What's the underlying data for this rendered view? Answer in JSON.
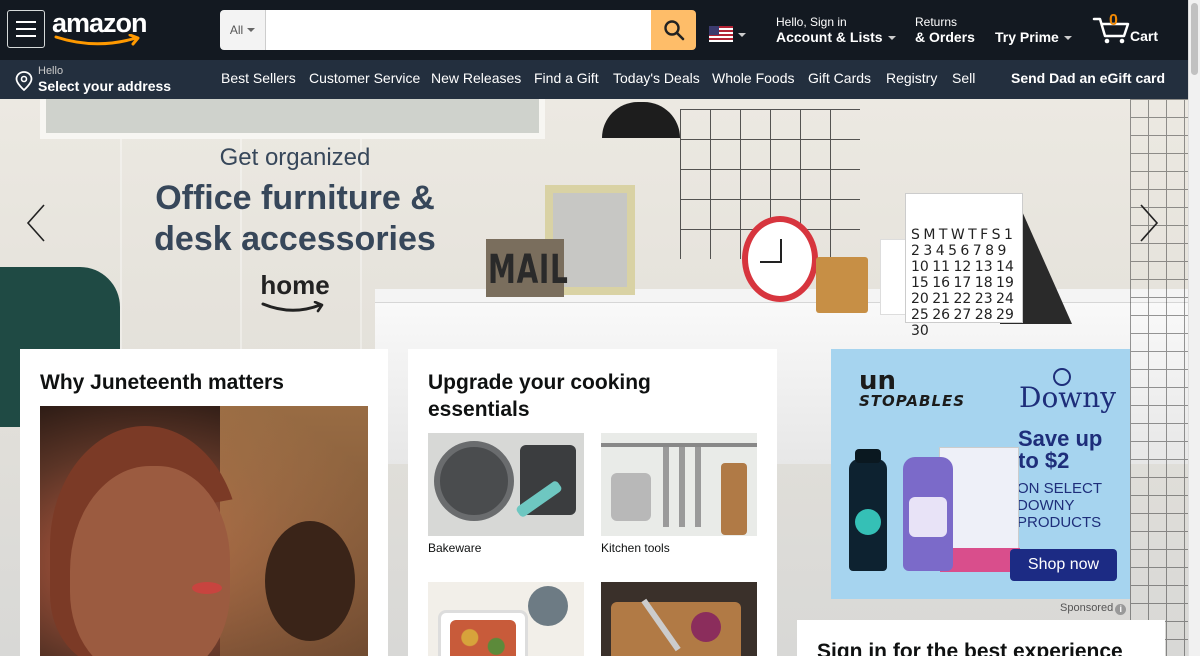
{
  "header": {
    "logo_text": "amazon",
    "search": {
      "category": "All",
      "placeholder": "",
      "value": ""
    },
    "flag": "us-flag-icon",
    "account": {
      "line1": "Hello, Sign in",
      "line2": "Account & Lists"
    },
    "orders": {
      "line1": "Returns",
      "line2": "& Orders"
    },
    "prime": {
      "label": "Try Prime"
    },
    "cart": {
      "count": "0",
      "label": "Cart"
    }
  },
  "subnav": {
    "address": {
      "line1": "Hello",
      "line2": "Select your address"
    },
    "links": [
      "Best Sellers",
      "Customer Service",
      "New Releases",
      "Find a Gift",
      "Today's Deals",
      "Whole Foods",
      "Gift Cards",
      "Registry",
      "Sell"
    ],
    "promo": "Send Dad an eGift card"
  },
  "hero": {
    "subtitle": "Get organized",
    "title": "Office furniture & desk accessories",
    "brand": "home",
    "mail_sign": "MAIL",
    "calendar_text": "S M T W T F S 1 2 3 4 5 6 7 8 9 10 11 12 13 14 15 16 17 18 19 20 21 22 23 24 25 26 27 28 29 30"
  },
  "cards": {
    "juneteenth": {
      "title": "Why Juneteenth matters"
    },
    "cooking": {
      "title": "Upgrade your cooking essentials",
      "tiles": [
        {
          "caption": "Bakeware"
        },
        {
          "caption": "Kitchen tools"
        },
        {
          "caption": ""
        },
        {
          "caption": ""
        }
      ]
    }
  },
  "ad": {
    "brand1": "un",
    "brand1_sub": "STOPABLES",
    "brand2": "Downy",
    "headline": "Save up to $2",
    "subline": "ON SELECT DOWNY PRODUCTS",
    "button": "Shop now",
    "sponsored": "Sponsored"
  },
  "signin": {
    "title": "Sign in for the best experience"
  },
  "colors": {
    "nav_top": "#131921",
    "nav_sub": "#232f3e",
    "search_button": "#febd69",
    "cart_count": "#f08804",
    "ad_bg": "#a6d4ef",
    "ad_button": "#1c2b84"
  }
}
